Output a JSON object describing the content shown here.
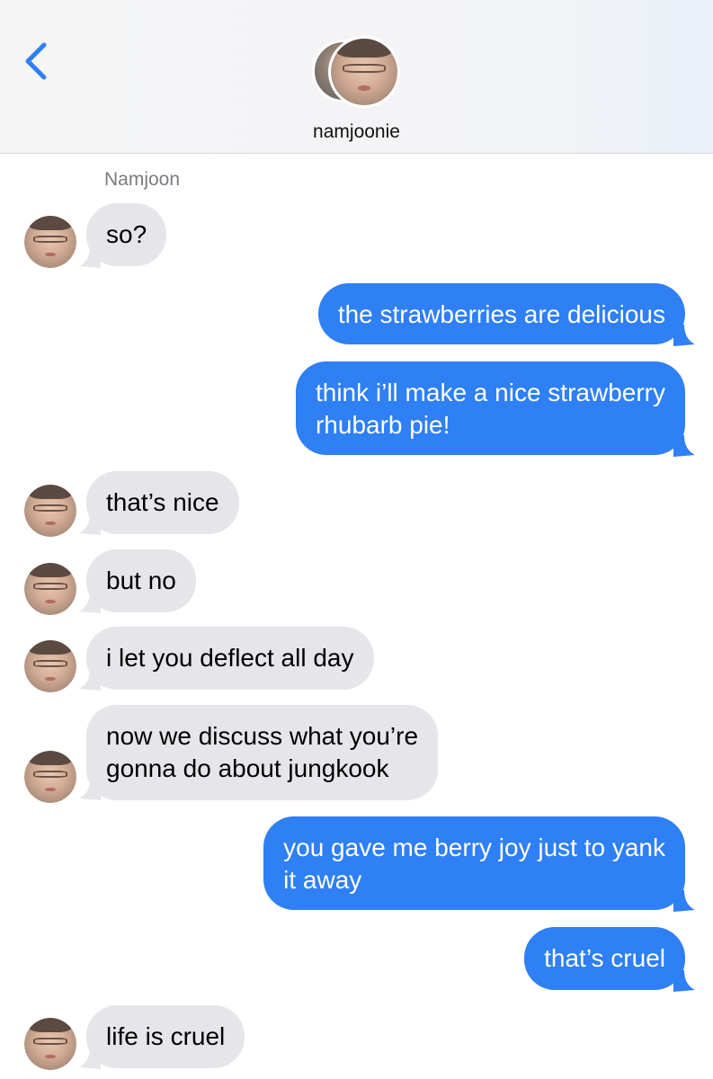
{
  "header": {
    "contact_name": "namjoonie"
  },
  "thread": {
    "sender_name": "Namjoon",
    "messages": [
      {
        "dir": "in",
        "text": "so?"
      },
      {
        "dir": "out",
        "text": "the strawberries are delicious"
      },
      {
        "dir": "out",
        "text": "think i’ll make a nice strawberry\nrhubarb pie!"
      },
      {
        "dir": "in",
        "text": "that’s nice"
      },
      {
        "dir": "in",
        "text": "but no"
      },
      {
        "dir": "in",
        "text": "i let you deflect all day"
      },
      {
        "dir": "in",
        "text": "now we discuss what you’re\ngonna do about jungkook"
      },
      {
        "dir": "out",
        "text": "you gave me berry joy just to yank\nit away"
      },
      {
        "dir": "out",
        "text": "that’s cruel"
      },
      {
        "dir": "in",
        "text": "life is cruel"
      }
    ]
  },
  "colors": {
    "outgoing_bubble": "#2f7ff5",
    "incoming_bubble": "#e6e6ea",
    "accent": "#2f7ff5"
  },
  "icons": {
    "back": "chevron-left-icon"
  }
}
